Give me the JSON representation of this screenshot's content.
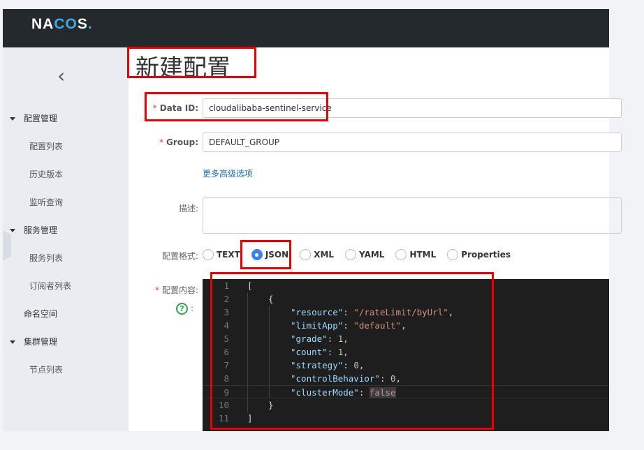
{
  "header": {
    "logo": "NACOS."
  },
  "sidebar": {
    "collapse_icon": "chevron-left-icon",
    "items": [
      {
        "label": "配置管理",
        "type": "group"
      },
      {
        "label": "配置列表",
        "type": "sub"
      },
      {
        "label": "历史版本",
        "type": "sub"
      },
      {
        "label": "监听查询",
        "type": "sub"
      },
      {
        "label": "服务管理",
        "type": "group"
      },
      {
        "label": "服务列表",
        "type": "sub"
      },
      {
        "label": "订阅者列表",
        "type": "sub"
      },
      {
        "label": "命名空间",
        "type": "top"
      },
      {
        "label": "集群管理",
        "type": "group"
      },
      {
        "label": "节点列表",
        "type": "sub"
      }
    ]
  },
  "main": {
    "title": "新建配置",
    "required_mark": "*",
    "data_id": {
      "label": "Data ID:",
      "value": "cloudalibaba-sentinel-service"
    },
    "group": {
      "label": "Group:",
      "value": "DEFAULT_GROUP"
    },
    "advanced_link": "更多高级选项",
    "description": {
      "label": "描述:",
      "value": ""
    },
    "format": {
      "label": "配置格式:",
      "options": [
        "TEXT",
        "JSON",
        "XML",
        "YAML",
        "HTML",
        "Properties"
      ],
      "selected": "JSON"
    },
    "content": {
      "label": "配置内容:",
      "help_colon": ":",
      "help_icon": "?"
    },
    "editor": {
      "line_numbers": [
        "1",
        "2",
        "3",
        "4",
        "5",
        "6",
        "7",
        "8",
        "9",
        "10",
        "11"
      ],
      "lines": {
        "l1": "[",
        "l2": "{",
        "resource_key": "\"resource\"",
        "resource_val": "\"/rateLimit/byUrl\"",
        "limitApp_key": "\"limitApp\"",
        "limitApp_val": "\"default\"",
        "grade_key": "\"grade\"",
        "grade_val": "1",
        "count_key": "\"count\"",
        "count_val": "1",
        "strategy_key": "\"strategy\"",
        "strategy_val": "0",
        "controlBehavior_key": "\"controlBehavior\"",
        "controlBehavior_val": "0",
        "clusterMode_key": "\"clusterMode\"",
        "clusterMode_val": "false",
        "l10": "}",
        "l11": "]"
      }
    }
  },
  "colors": {
    "header": "#24292e",
    "sidebar": "#e9ecf1",
    "accent": "#3b82f6",
    "highlight": "#e00000",
    "link": "#1a6fc4"
  }
}
